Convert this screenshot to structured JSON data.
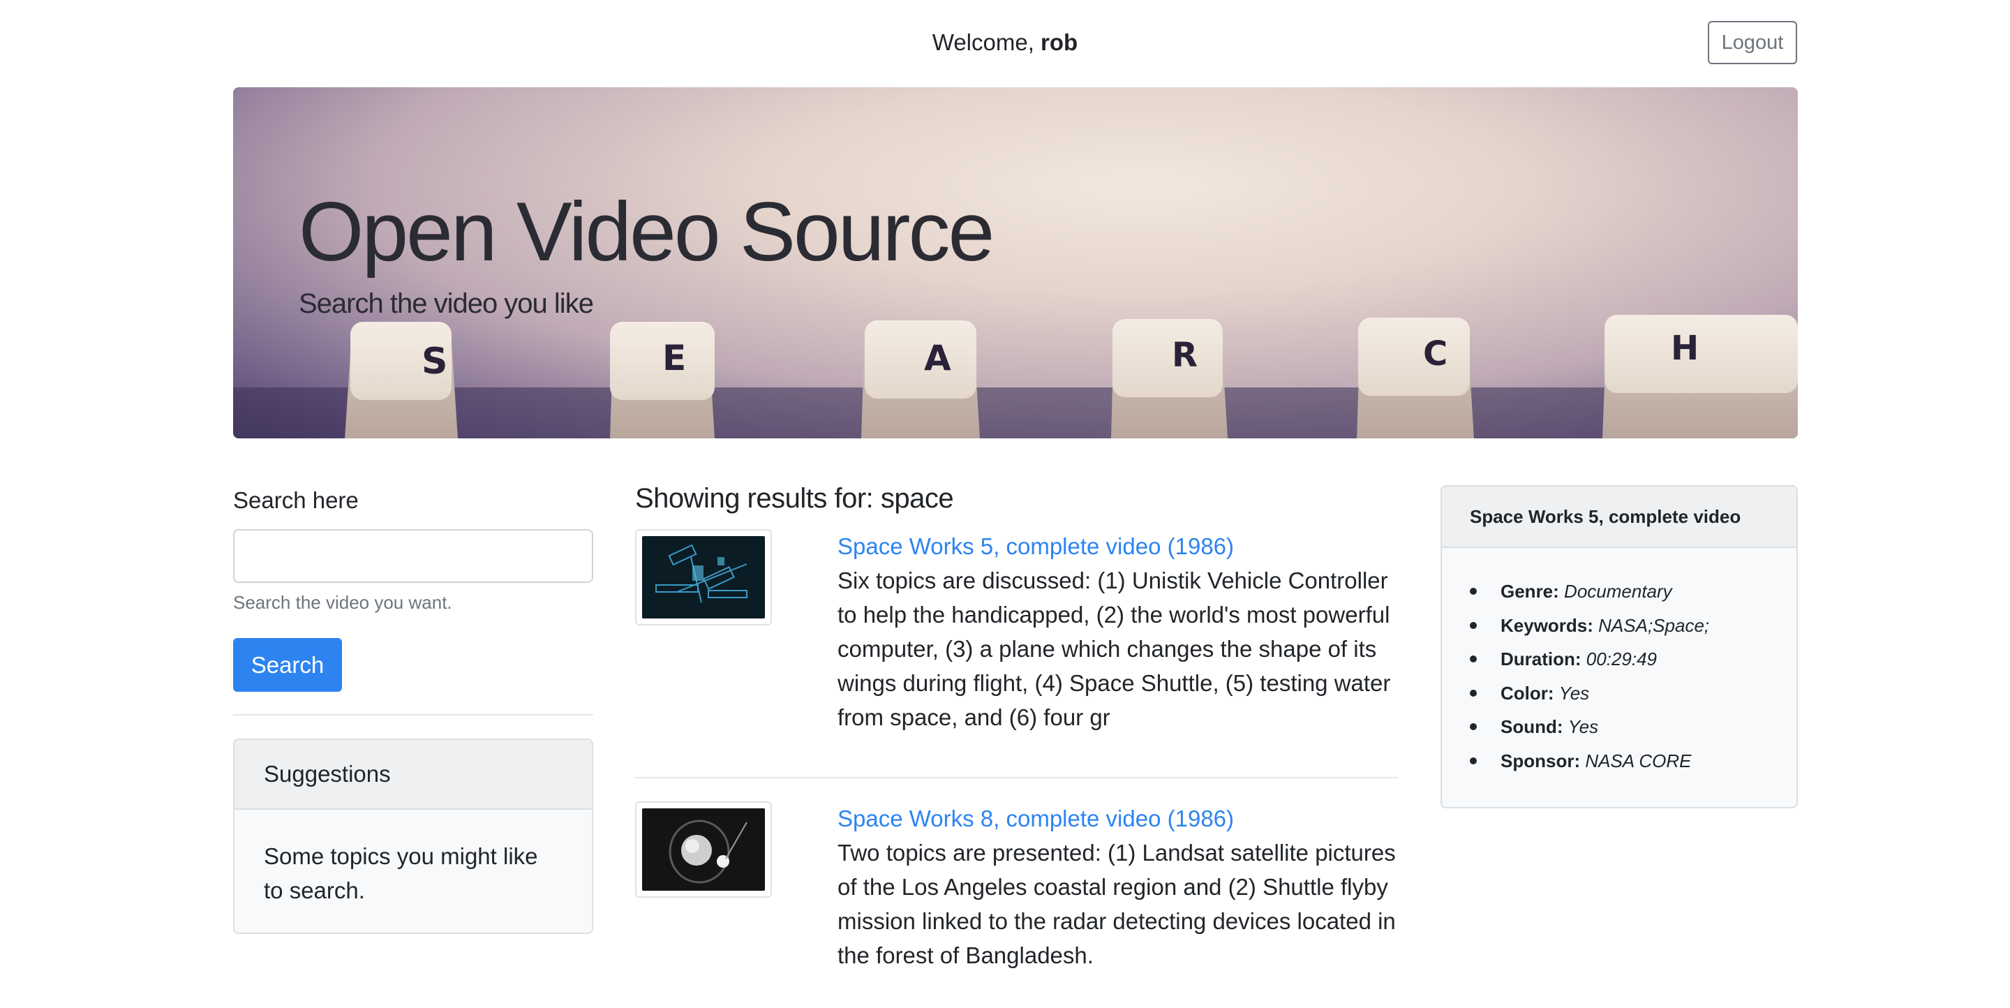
{
  "header": {
    "welcome_prefix": "Welcome, ",
    "username": "rob",
    "logout_label": "Logout"
  },
  "hero": {
    "title": "Open Video Source",
    "subtitle": "Search the video you like",
    "keyboard_letters": [
      "S",
      "E",
      "A",
      "R",
      "C",
      "H"
    ]
  },
  "search": {
    "label": "Search here",
    "input_value": "",
    "help_text": "Search the video you want.",
    "button_label": "Search"
  },
  "suggestions": {
    "header": "Suggestions",
    "body": "Some topics you might like to search."
  },
  "results": {
    "heading": "Showing results for: space",
    "items": [
      {
        "title": "Space Works 5, complete video (1986)",
        "description": "Six topics are discussed: (1) Unistik Vehicle Controller to help the handicapped, (2) the world's most powerful computer, (3) a plane which changes the shape of its wings during flight, (4) Space Shuttle, (5) testing water from space, and (6) four gr"
      },
      {
        "title": "Space Works 8, complete video (1986)",
        "description": "Two topics are presented: (1) Landsat satellite pictures of the Los Angeles coastal region and (2) Shuttle flyby mission linked to the radar detecting devices located in the forest of Bangladesh."
      }
    ]
  },
  "details": {
    "header": "Space Works 5, complete video",
    "fields": [
      {
        "key": "Genre:",
        "value": "Documentary"
      },
      {
        "key": "Keywords:",
        "value": "NASA;Space;"
      },
      {
        "key": "Duration:",
        "value": "00:29:49"
      },
      {
        "key": "Color:",
        "value": "Yes"
      },
      {
        "key": "Sound:",
        "value": "Yes"
      },
      {
        "key": "Sponsor:",
        "value": "NASA CORE"
      }
    ]
  },
  "colors": {
    "primary": "#2d84f1",
    "text": "#212529",
    "muted": "#6c757d",
    "card_bg": "#f8f9fa",
    "card_header_bg": "#eef0f2"
  }
}
